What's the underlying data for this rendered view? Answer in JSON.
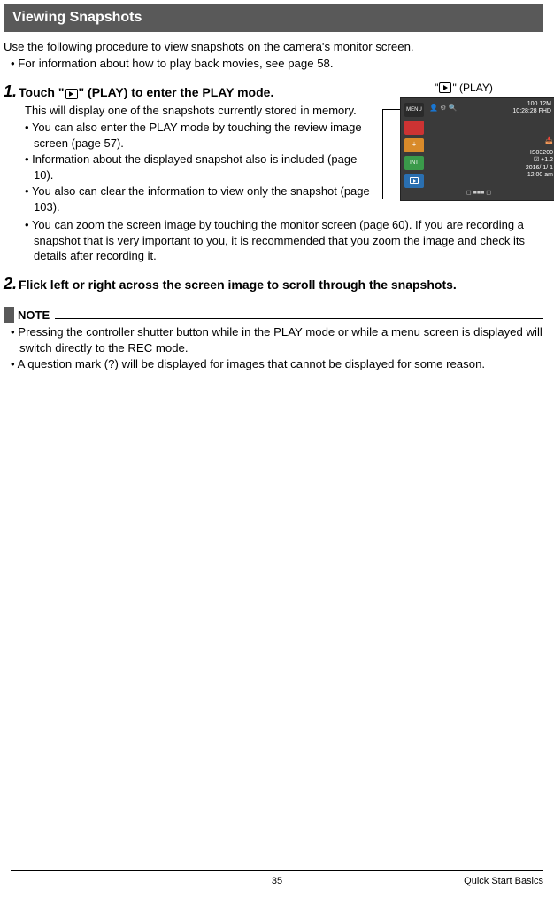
{
  "titlebar": "Viewing Snapshots",
  "intro": "Use the following procedure to view snapshots on the camera's monitor screen.",
  "intro_bullet": "For information about how to play back movies, see page 58.",
  "step1": {
    "num": "1.",
    "head_pre": "Touch \"",
    "head_post": "\" (PLAY) to enter the PLAY mode.",
    "body": "This will display one of the snapshots currently stored in memory.",
    "subs": [
      "You can also enter the PLAY mode by touching the review image screen (page 57).",
      "Information about the displayed snapshot also is included (page 10).",
      "You also can clear the information to view only the snapshot (page 103)."
    ],
    "wide_sub": "You can zoom the screen image by touching the monitor screen (page 60). If you are recording a snapshot that is very important to you, it is recommended that you zoom the image and check its details after recording it."
  },
  "step2": {
    "num": "2.",
    "head": "Flick left or right across the screen image to scroll through the snapshots."
  },
  "note": {
    "label": "NOTE",
    "items": [
      "Pressing the controller shutter button while in the PLAY mode or while a menu screen is displayed will switch directly to the REC mode.",
      "A question mark (?) will be displayed for images that cannot be displayed for some reason."
    ]
  },
  "figure": {
    "label_pre": "\"",
    "label_post": "\" (PLAY)",
    "menu": "MENU",
    "top_r1": "100 12M",
    "top_r2": "10:28:28 FHD",
    "right": {
      "iso": "IS03200",
      "ev": "☑ +1.2",
      "date": "2016/ 1/ 1",
      "time": "12:00 am"
    },
    "bottom": "◻ ■■■ ◻"
  },
  "footer": {
    "page": "35",
    "section": "Quick Start Basics"
  }
}
